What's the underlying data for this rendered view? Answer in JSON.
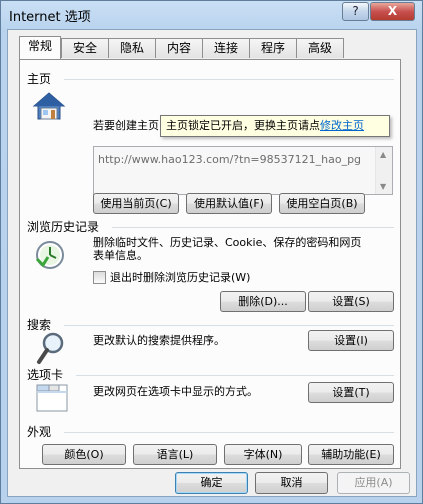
{
  "window": {
    "title": "Internet 选项",
    "help_label": "?",
    "close_label": "X"
  },
  "tabs": [
    {
      "label": "常规",
      "active": true
    },
    {
      "label": "安全"
    },
    {
      "label": "隐私"
    },
    {
      "label": "内容"
    },
    {
      "label": "连接"
    },
    {
      "label": "程序"
    },
    {
      "label": "高级"
    }
  ],
  "homepage": {
    "section_label": "主页",
    "description": "若要创建主页",
    "url": "http://www.hao123.com/?tn=98537121_hao_pg",
    "tooltip_text": "主页锁定已开启，更换主页请点",
    "tooltip_link": "修改主页",
    "btn_current": "使用当前页(C)",
    "btn_default": "使用默认值(F)",
    "btn_blank": "使用空白页(B)"
  },
  "history": {
    "section_label": "浏览历史记录",
    "description_line1": "删除临时文件、历史记录、Cookie、保存的密码和网页",
    "description_line2": "表单信息。",
    "checkbox_label": "退出时删除浏览历史记录(W)",
    "checkbox_checked": false,
    "btn_delete": "删除(D)...",
    "btn_settings": "设置(S)"
  },
  "search": {
    "section_label": "搜索",
    "description": "更改默认的搜索提供程序。",
    "btn_settings": "设置(I)"
  },
  "tabs_section": {
    "section_label": "选项卡",
    "description": "更改网页在选项卡中显示的方式。",
    "btn_settings": "设置(T)"
  },
  "appearance": {
    "section_label": "外观",
    "btn_colors": "颜色(O)",
    "btn_languages": "语言(L)",
    "btn_fonts": "字体(N)",
    "btn_accessibility": "辅助功能(E)"
  },
  "footer": {
    "ok": "确定",
    "cancel": "取消",
    "apply": "应用(A)"
  },
  "colors": {
    "title_bg": "#b9d3ee",
    "close_red": "#c75050",
    "tooltip_bg": "#ffffe1",
    "link": "#0066cc",
    "separator": "#d5dfe5"
  },
  "icons": [
    "home-icon",
    "history-clock-icon",
    "search-magnifier-icon",
    "tabs-window-icon"
  ]
}
